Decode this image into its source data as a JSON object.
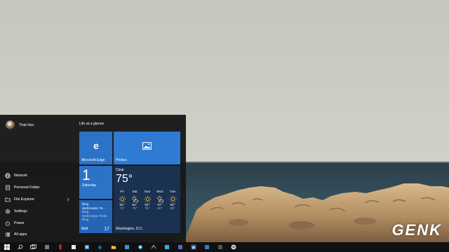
{
  "user": {
    "name": "Thái Học"
  },
  "start_menu": {
    "items": [
      {
        "label": "Network",
        "icon": "network-icon"
      },
      {
        "label": "Personal Folder",
        "icon": "folder-icon"
      },
      {
        "label": "File Explorer",
        "icon": "file-explorer-icon",
        "has_submenu": true
      },
      {
        "label": "Settings",
        "icon": "gear-icon"
      },
      {
        "label": "Power",
        "icon": "power-icon"
      },
      {
        "label": "All apps",
        "icon": "all-apps-icon"
      }
    ],
    "tile_group_title": "Life at a glance"
  },
  "tiles": {
    "edge": {
      "label": "Microsoft Edge",
      "logo": "e"
    },
    "photos": {
      "label": "Photos"
    },
    "calendar": {
      "day": "1",
      "weekday": "Saturday"
    },
    "mail": {
      "line1": "Bing",
      "line2": "Webmaster Te...",
      "line3": "Bing",
      "line4": "Webmaster Tools",
      "line5": "Bing",
      "label": "Mail",
      "count": "17"
    },
    "weather": {
      "condition": "Clear",
      "temp": "75°",
      "location": "Washington, D.C.",
      "forecast": [
        {
          "day": "Fri",
          "high": "92°",
          "low": "73°"
        },
        {
          "day": "Sat",
          "high": "91°",
          "low": "75°"
        },
        {
          "day": "Sun",
          "high": "92°",
          "low": "76°"
        },
        {
          "day": "Mon",
          "high": "97°",
          "low": "80°"
        },
        {
          "day": "Tue",
          "high": "93°",
          "low": "80°"
        }
      ]
    }
  },
  "taskbar": {
    "icons": [
      "windows-logo-icon",
      "search-icon",
      "task-view-icon",
      "app-icon-1",
      "app-icon-2",
      "app-icon-3",
      "app-icon-4",
      "edge-taskbar-icon",
      "app-icon-5",
      "app-icon-6",
      "app-icon-7",
      "app-icon-8",
      "app-icon-9",
      "word-icon",
      "app-icon-10",
      "app-icon-11",
      "chrome-icon"
    ]
  },
  "watermark": "GENK",
  "colors": {
    "accent": "#2b73c7",
    "start_bg": "#181818",
    "taskbar_bg": "#101010",
    "weather_tile": "#1a3152"
  }
}
